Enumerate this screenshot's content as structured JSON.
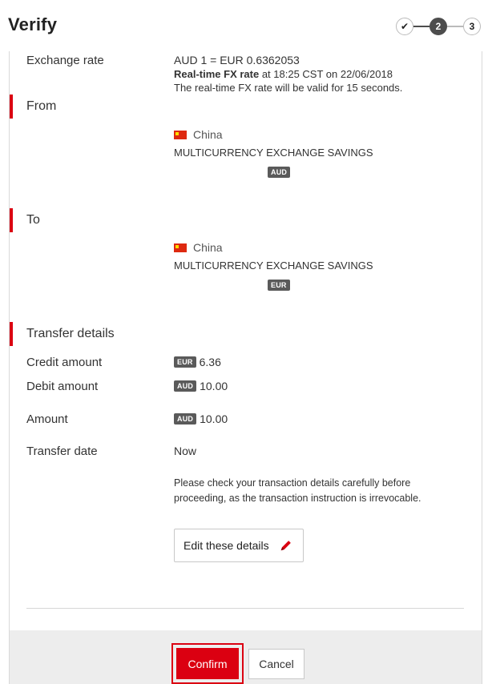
{
  "header": {
    "title": "Verify",
    "steps": [
      "✔",
      "2",
      "3"
    ]
  },
  "exchange": {
    "label": "Exchange rate",
    "rate": "AUD 1 = EUR 0.6362053",
    "realtime_bold": "Real-time FX rate",
    "realtime_rest": " at 18:25 CST on 22/06/2018",
    "validity": "The real-time FX rate will be valid for 15 seconds."
  },
  "from": {
    "heading": "From",
    "country": "China",
    "account": "MULTICURRENCY EXCHANGE SAVINGS",
    "currency": "AUD"
  },
  "to": {
    "heading": "To",
    "country": "China",
    "account": "MULTICURRENCY EXCHANGE SAVINGS",
    "currency": "EUR"
  },
  "transfer": {
    "heading": "Transfer details",
    "credit_label": "Credit amount",
    "credit_currency": "EUR",
    "credit_value": "6.36",
    "debit_label": "Debit amount",
    "debit_currency": "AUD",
    "debit_value": "10.00",
    "amount_label": "Amount",
    "amount_currency": "AUD",
    "amount_value": "10.00",
    "date_label": "Transfer date",
    "date_value": "Now"
  },
  "notice": "Please check your transaction details carefully before proceeding, as the transaction instruction is irrevocable.",
  "actions": {
    "edit_label": "Edit these details",
    "confirm_label": "Confirm",
    "cancel_label": "Cancel"
  },
  "colors": {
    "accent": "#db0011",
    "badge": "#5a5a5a"
  }
}
